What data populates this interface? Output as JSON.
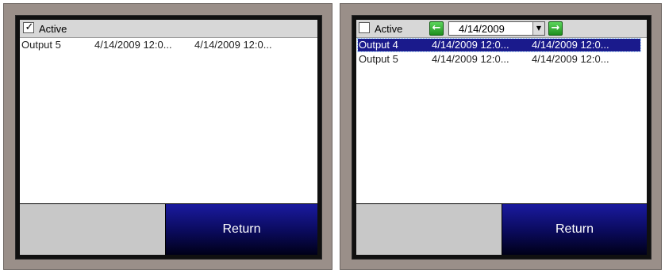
{
  "left_panel": {
    "active_checkbox": {
      "label": "Active",
      "checked": true,
      "check_glyph": "✓"
    },
    "rows": [
      {
        "name": "Output 5",
        "start": "4/14/2009 12:0...",
        "end": "4/14/2009 12:0..."
      }
    ],
    "return_label": "Return"
  },
  "right_panel": {
    "active_checkbox": {
      "label": "Active",
      "checked": false
    },
    "date_selector": {
      "value": "4/14/2009",
      "prev_icon": "←",
      "next_icon": "→",
      "dropdown_icon": "▼"
    },
    "rows": [
      {
        "name": "Output 4",
        "start": "4/14/2009 12:0...",
        "end": "4/14/2009 12:0...",
        "selected": true
      },
      {
        "name": "Output 5",
        "start": "4/14/2009 12:0...",
        "end": "4/14/2009 12:0...",
        "selected": false
      }
    ],
    "return_label": "Return"
  },
  "colors": {
    "frame": "#9a8f89",
    "bezel": "#101010",
    "toolbar": "#d7d7d7",
    "selection": "#1a1a8c",
    "return_button": "#0a0a5a",
    "nav_button": "#2eaa2e"
  }
}
